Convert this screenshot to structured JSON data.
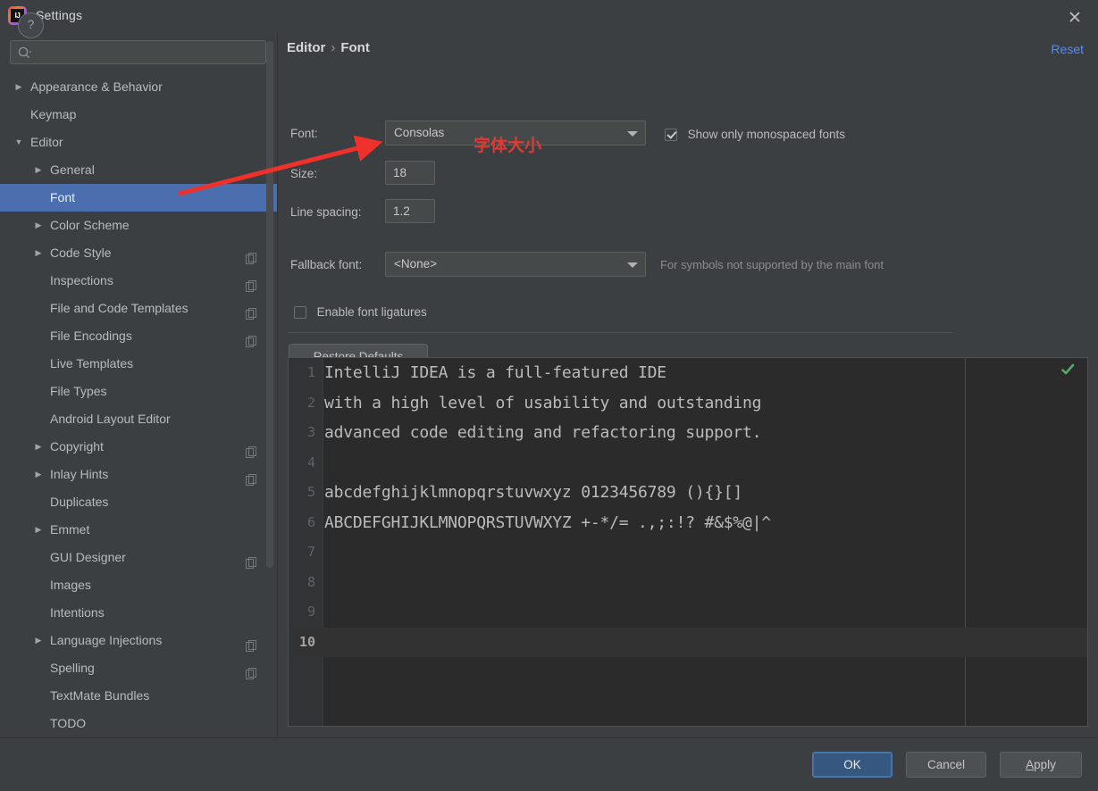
{
  "window": {
    "title": "Settings",
    "logo_icon": "intellij-idea-logo",
    "close_icon": "close-icon"
  },
  "search": {
    "value": "",
    "placeholder": "",
    "icon": "search-icon"
  },
  "sidebar": {
    "scrollbar": "vertical-scrollbar",
    "items": [
      {
        "label": "Appearance & Behavior",
        "level": 0,
        "arrow": "▶",
        "badge": false,
        "selected": false
      },
      {
        "label": "Keymap",
        "level": 0,
        "arrow": "",
        "badge": false,
        "selected": false
      },
      {
        "label": "Editor",
        "level": 0,
        "arrow": "▼",
        "badge": false,
        "selected": false
      },
      {
        "label": "General",
        "level": 1,
        "arrow": "▶",
        "badge": false,
        "selected": false
      },
      {
        "label": "Font",
        "level": 1,
        "arrow": "",
        "badge": false,
        "selected": true
      },
      {
        "label": "Color Scheme",
        "level": 1,
        "arrow": "▶",
        "badge": false,
        "selected": false
      },
      {
        "label": "Code Style",
        "level": 1,
        "arrow": "▶",
        "badge": true,
        "selected": false
      },
      {
        "label": "Inspections",
        "level": 1,
        "arrow": "",
        "badge": true,
        "selected": false
      },
      {
        "label": "File and Code Templates",
        "level": 1,
        "arrow": "",
        "badge": true,
        "selected": false
      },
      {
        "label": "File Encodings",
        "level": 1,
        "arrow": "",
        "badge": true,
        "selected": false
      },
      {
        "label": "Live Templates",
        "level": 1,
        "arrow": "",
        "badge": false,
        "selected": false
      },
      {
        "label": "File Types",
        "level": 1,
        "arrow": "",
        "badge": false,
        "selected": false
      },
      {
        "label": "Android Layout Editor",
        "level": 1,
        "arrow": "",
        "badge": false,
        "selected": false
      },
      {
        "label": "Copyright",
        "level": 1,
        "arrow": "▶",
        "badge": true,
        "selected": false
      },
      {
        "label": "Inlay Hints",
        "level": 1,
        "arrow": "▶",
        "badge": true,
        "selected": false
      },
      {
        "label": "Duplicates",
        "level": 1,
        "arrow": "",
        "badge": false,
        "selected": false
      },
      {
        "label": "Emmet",
        "level": 1,
        "arrow": "▶",
        "badge": false,
        "selected": false
      },
      {
        "label": "GUI Designer",
        "level": 1,
        "arrow": "",
        "badge": true,
        "selected": false
      },
      {
        "label": "Images",
        "level": 1,
        "arrow": "",
        "badge": false,
        "selected": false
      },
      {
        "label": "Intentions",
        "level": 1,
        "arrow": "",
        "badge": false,
        "selected": false
      },
      {
        "label": "Language Injections",
        "level": 1,
        "arrow": "▶",
        "badge": true,
        "selected": false
      },
      {
        "label": "Spelling",
        "level": 1,
        "arrow": "",
        "badge": true,
        "selected": false
      },
      {
        "label": "TextMate Bundles",
        "level": 1,
        "arrow": "",
        "badge": false,
        "selected": false
      },
      {
        "label": "TODO",
        "level": 1,
        "arrow": "",
        "badge": false,
        "selected": false
      }
    ]
  },
  "main": {
    "breadcrumb": {
      "root": "Editor",
      "separator": "›",
      "current": "Font"
    },
    "reset_label": "Reset",
    "font": {
      "label": "Font:",
      "value": "Consolas",
      "dropdown_icon": "chevron-down-icon"
    },
    "monospaced": {
      "label": "Show only monospaced fonts",
      "checked": true
    },
    "size": {
      "label": "Size:",
      "value": "18"
    },
    "line_spacing": {
      "label": "Line spacing:",
      "value": "1.2"
    },
    "fallback": {
      "label": "Fallback font:",
      "value": "<None>",
      "hint": "For symbols not supported by the main font",
      "dropdown_icon": "chevron-down-icon"
    },
    "ligatures": {
      "label": "Enable font ligatures",
      "checked": false
    },
    "restore_defaults_label": "Restore Defaults",
    "preview": {
      "inspection_icon": "inspection-ok-checkmark",
      "current_line": 10,
      "lines": [
        {
          "num": "1",
          "text": "IntelliJ IDEA is a full-featured IDE"
        },
        {
          "num": "2",
          "text": "with a high level of usability and outstanding"
        },
        {
          "num": "3",
          "text": "advanced code editing and refactoring support."
        },
        {
          "num": "4",
          "text": ""
        },
        {
          "num": "5",
          "text": "abcdefghijklmnopqrstuvwxyz 0123456789 (){}[]"
        },
        {
          "num": "6",
          "text": "ABCDEFGHIJKLMNOPQRSTUVWXYZ +-*/= .,;:!? #&$%@|^"
        },
        {
          "num": "7",
          "text": ""
        },
        {
          "num": "8",
          "text": ""
        },
        {
          "num": "9",
          "text": ""
        },
        {
          "num": "10",
          "text": ""
        }
      ]
    }
  },
  "bottom": {
    "help_label": "?",
    "ok_label": "OK",
    "cancel_label": "Cancel",
    "apply_mnemonic": "A",
    "apply_rest": "pply"
  },
  "annotation": {
    "text": "字体大小",
    "color": "#e03a34",
    "arrow_icon": "red-arrow-annotation"
  },
  "colors": {
    "dialog_bg": "#3c3f41",
    "selection_blue": "#4b6eaf",
    "link_blue": "#548af7",
    "editor_bg": "#2b2b2b",
    "annotation_red": "#e03a34"
  }
}
